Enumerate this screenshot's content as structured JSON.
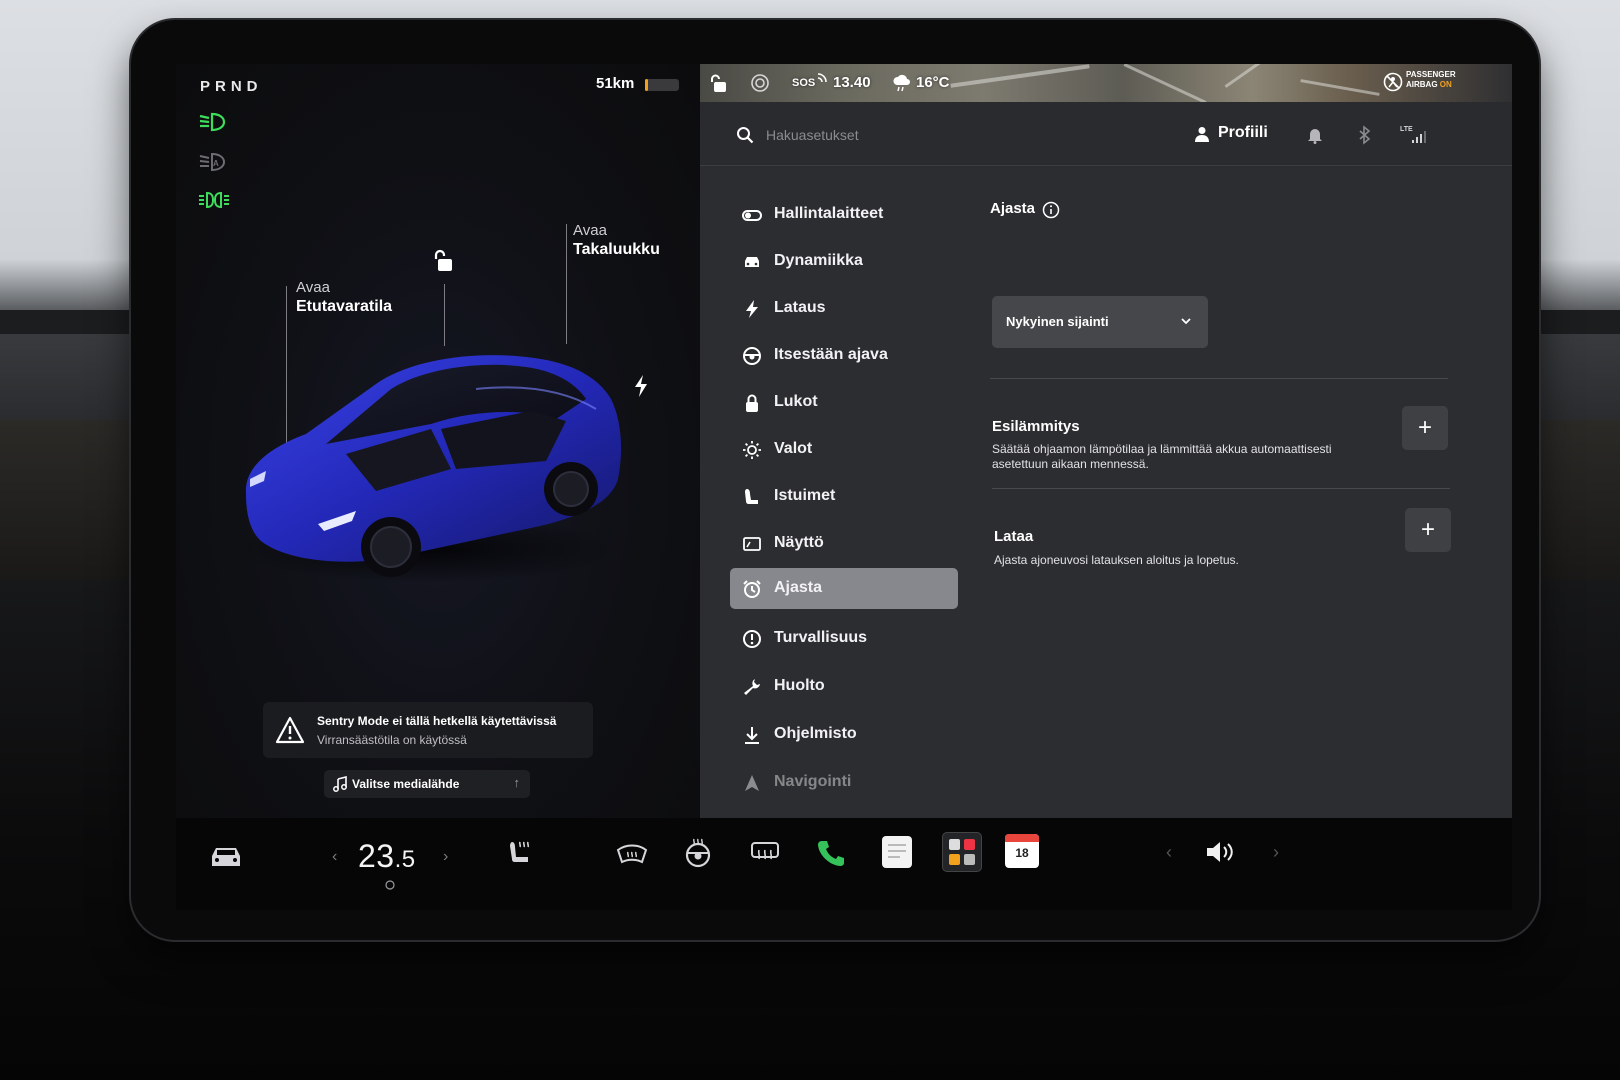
{
  "status_bar": {
    "gear": "PRND",
    "range": "51km",
    "time": "13.40",
    "temperature": "16°C",
    "sos": "SOS",
    "airbag_line1": "PASSENGER",
    "airbag_line2": "AIRBAG",
    "airbag_state": "ON",
    "lte": "LTE"
  },
  "car_view": {
    "frunk_label_top": "Avaa",
    "frunk_label_bottom": "Etutavaratila",
    "trunk_label_top": "Avaa",
    "trunk_label_bottom": "Takaluukku",
    "car_color": "#2a2fc9"
  },
  "alert": {
    "title": "Sentry Mode ei tällä hetkellä käytettävissä",
    "subtitle": "Virransäästötila on käytössä"
  },
  "media": {
    "label": "Valitse medialähde"
  },
  "topbar": {
    "search_placeholder": "Hakuasetukset",
    "profile_label": "Profiili"
  },
  "nav": {
    "items": [
      {
        "label": "Hallintalaitteet",
        "icon": "toggle-icon"
      },
      {
        "label": "Dynamiikka",
        "icon": "car-icon"
      },
      {
        "label": "Lataus",
        "icon": "bolt-icon"
      },
      {
        "label": "Itsestään ajava",
        "icon": "steering-wheel-icon"
      },
      {
        "label": "Lukot",
        "icon": "lock-icon"
      },
      {
        "label": "Valot",
        "icon": "sun-icon"
      },
      {
        "label": "Istuimet",
        "icon": "seat-icon"
      },
      {
        "label": "Näyttö",
        "icon": "display-icon"
      },
      {
        "label": "Ajasta",
        "icon": "alarm-clock-icon",
        "active": true
      },
      {
        "label": "Turvallisuus",
        "icon": "alert-circle-icon"
      },
      {
        "label": "Huolto",
        "icon": "wrench-icon"
      },
      {
        "label": "Ohjelmisto",
        "icon": "download-icon"
      },
      {
        "label": "Navigointi",
        "icon": "navigation-icon"
      }
    ]
  },
  "schedule": {
    "title": "Ajasta",
    "location_value": "Nykyinen sijainti",
    "preheat_title": "Esilämmitys",
    "preheat_desc_line1": "Säätää ohjaamon lämpötilaa ja lämmittää akkua automaattisesti",
    "preheat_desc_line2": "asetettuun aikaan mennessä.",
    "charge_title": "Lataa",
    "charge_desc": "Ajasta ajoneuvosi latauksen aloitus ja lopetus.",
    "add_symbol": "+"
  },
  "bottom_bar": {
    "temp_whole": "23",
    "temp_decimal": ".5",
    "calendar_day": "18",
    "prev_glyph": "‹",
    "next_glyph": "›"
  },
  "colors": {
    "accent_green": "#3ddc5b",
    "phone_green": "#36c25a",
    "battery_orange": "#f2a11f",
    "active_nav_bg": "#86888d"
  }
}
